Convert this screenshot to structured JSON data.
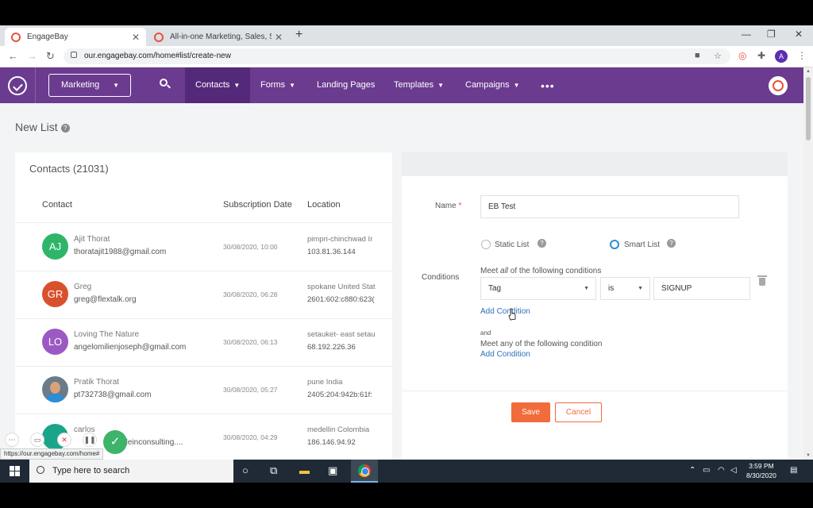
{
  "browser": {
    "tabs": [
      {
        "title": "EngageBay",
        "active": true
      },
      {
        "title": "All-in-one Marketing, Sales, Supp",
        "active": false
      }
    ],
    "url": "our.engagebay.com/home#list/create-new",
    "profile_initial": "A"
  },
  "appnav": {
    "workspace": "Marketing",
    "items": [
      {
        "label": "Contacts",
        "active": true,
        "dropdown": true
      },
      {
        "label": "Forms",
        "active": false,
        "dropdown": true
      },
      {
        "label": "Landing Pages",
        "active": false,
        "dropdown": false
      },
      {
        "label": "Templates",
        "active": false,
        "dropdown": true
      },
      {
        "label": "Campaigns",
        "active": false,
        "dropdown": true
      }
    ],
    "more": "•••",
    "accent_color": "#6b3b8f"
  },
  "page": {
    "title": "New List",
    "help": "?"
  },
  "contacts": {
    "title": "Contacts (21031)",
    "headers": {
      "contact": "Contact",
      "date": "Subscription Date",
      "location": "Location"
    },
    "rows": [
      {
        "initials": "AJ",
        "color": "#2fb56a",
        "name": "Ajit Thorat",
        "email": "thoratajit1988@gmail.com",
        "date": "30/08/2020, 10:00",
        "loc": "pimpri-chinchwad Ir",
        "ip": "103.81.36.144"
      },
      {
        "initials": "GR",
        "color": "#d9512c",
        "name": "Greg",
        "email": "greg@flextalk.org",
        "date": "30/08/2020, 06:28",
        "loc": "spokane United Stat",
        "ip": "2601:602:c880:623("
      },
      {
        "initials": "LO",
        "color": "#9b59c4",
        "name": "Loving The Nature",
        "email": "angelomilienjoseph@gmail.com",
        "date": "30/08/2020, 06:13",
        "loc": "setauket- east setau",
        "ip": "68.192.226.36"
      },
      {
        "initials": "",
        "color": "#6b7b8a",
        "name": "Pratik Thorat",
        "email": "pt732738@gmail.com",
        "date": "30/08/2020, 05:27",
        "loc": "pune India",
        "ip": "2405:204:942b:61f:"
      },
      {
        "initials": "",
        "color": "#1aa58a",
        "name": "carlos",
        "email": "terleinconsulting....",
        "date": "30/08/2020, 04:29",
        "loc": "medellin Colombia",
        "ip": "186.146.94.92"
      }
    ]
  },
  "form": {
    "name_label": "Name",
    "required_mark": "*",
    "name_value": "EB Test",
    "static_label": "Static List",
    "smart_label": "Smart List",
    "help": "?",
    "conditions_label": "Conditions",
    "meet_prefix": "Meet ",
    "meet_all_word": "all",
    "meet_suffix": " of the following conditions",
    "field_value": "Tag",
    "operator_value": "is",
    "condition_value": "SIGNUP",
    "add_condition": "Add Condition",
    "and_text": "and",
    "meet_any": "Meet any of the following condition",
    "add_condition2": "Add Condition",
    "save": "Save",
    "cancel": "Cancel"
  },
  "status_url": "https://our.engagebay.com/home#",
  "taskbar": {
    "search_placeholder": "Type here to search",
    "time": "3:59 PM",
    "date": "8/30/2020"
  }
}
